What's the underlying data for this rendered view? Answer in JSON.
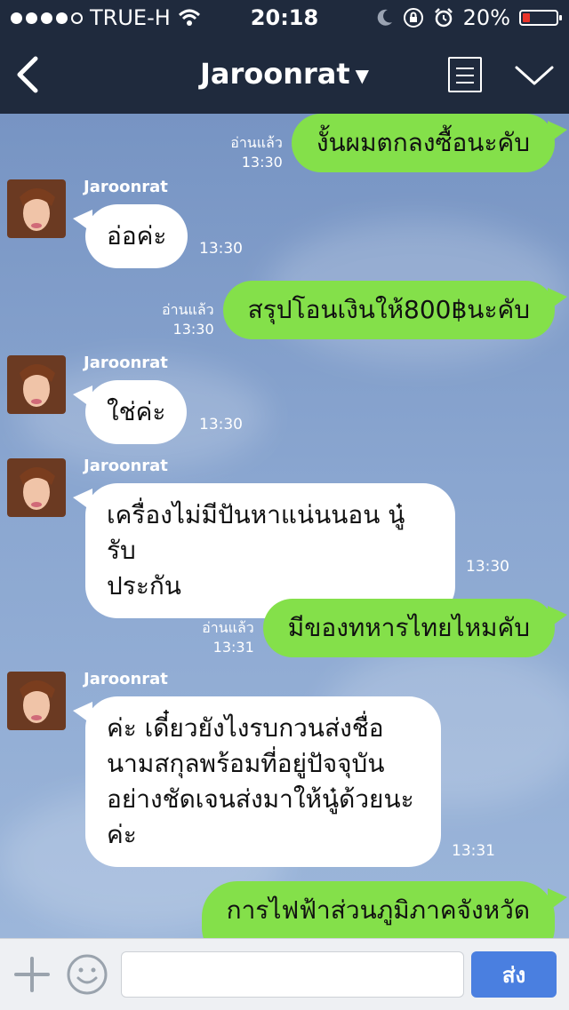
{
  "status_bar": {
    "carrier": "TRUE-H",
    "time": "20:18",
    "battery_percent": "20%",
    "battery_level": 0.2,
    "signal_bars_filled": 4,
    "signal_bars_total": 5,
    "icons": [
      "wifi-icon",
      "moon-icon",
      "rotation-lock-icon",
      "alarm-icon",
      "battery-icon"
    ]
  },
  "nav": {
    "title": "Jaroonrat",
    "icons": [
      "back-chevron-icon",
      "dropdown-caret-icon",
      "menu-list-icon",
      "collapse-chevron-icon"
    ]
  },
  "messages": [
    {
      "dir": "out",
      "read_label": "อ่านแล้ว",
      "time": "13:30",
      "text": "งั้นผมตกลงซื้อนะคับ"
    },
    {
      "dir": "in",
      "sender": "Jaroonrat",
      "time": "13:30",
      "text": "อ่อค่ะ"
    },
    {
      "dir": "out",
      "read_label": "อ่านแล้ว",
      "time": "13:30",
      "text": "สรุปโอนเงินให้800฿นะคับ"
    },
    {
      "dir": "in",
      "sender": "Jaroonrat",
      "time": "13:30",
      "text": "ใช่ค่ะ"
    },
    {
      "dir": "in",
      "sender": "Jaroonrat",
      "time": "13:30",
      "lines": [
        "เครื่องไม่มีปันหาแน่นนอน นู๋รับ",
        "ประกัน"
      ]
    },
    {
      "dir": "out",
      "read_label": "อ่านแล้ว",
      "time": "13:31",
      "text": "มีของทหารไทยไหมคับ"
    },
    {
      "dir": "in",
      "sender": "Jaroonrat",
      "time": "13:31",
      "lines": [
        "ค่ะ เดี๋ยวยังไงรบกวนส่งชื่อ",
        "นามสกุลพร้อมที่อยู่ปัจจุบัน",
        "อย่างชัดเจนส่งมาให้นู๋ด้วยนะ",
        "ค่ะ"
      ]
    },
    {
      "dir": "out",
      "text": "การไฟฟ้าส่วนภูมิภาคจังหวัด"
    }
  ],
  "input_bar": {
    "placeholder": "",
    "send_label": "ส่ง",
    "icons": [
      "plus-icon",
      "emoji-icon"
    ]
  },
  "colors": {
    "header_bg": "#1f2a3d",
    "outgoing_bubble": "#84e04a",
    "incoming_bubble": "#ffffff",
    "send_button": "#4a7fe0",
    "chat_bg": "#7a97c4"
  }
}
